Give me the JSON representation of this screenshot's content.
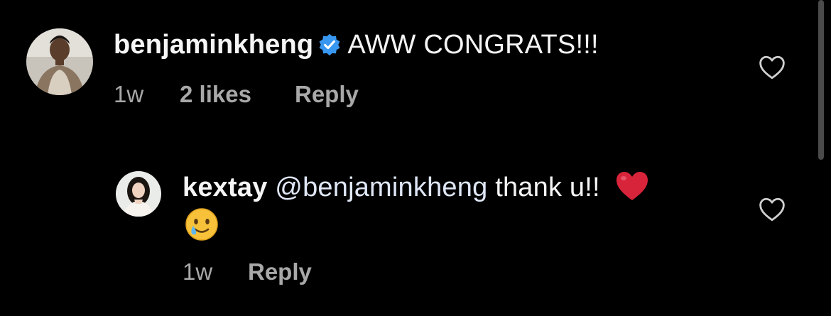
{
  "comments": [
    {
      "username": "benjaminkheng",
      "verified": true,
      "text": "AWW CONGRATS!!!",
      "time": "1w",
      "likes": "2 likes",
      "reply_label": "Reply"
    }
  ],
  "reply": {
    "username": "kextay",
    "mention": "@benjaminkheng",
    "text": "thank u!!",
    "emojis": [
      "red-heart",
      "smiling-face-with-tear"
    ],
    "time": "1w",
    "reply_label": "Reply"
  },
  "colors": {
    "background": "#000000",
    "text": "#f5f5f5",
    "meta": "#a8a8a8",
    "verified": "#3897f0",
    "heart_emoji": "#d8243a"
  }
}
